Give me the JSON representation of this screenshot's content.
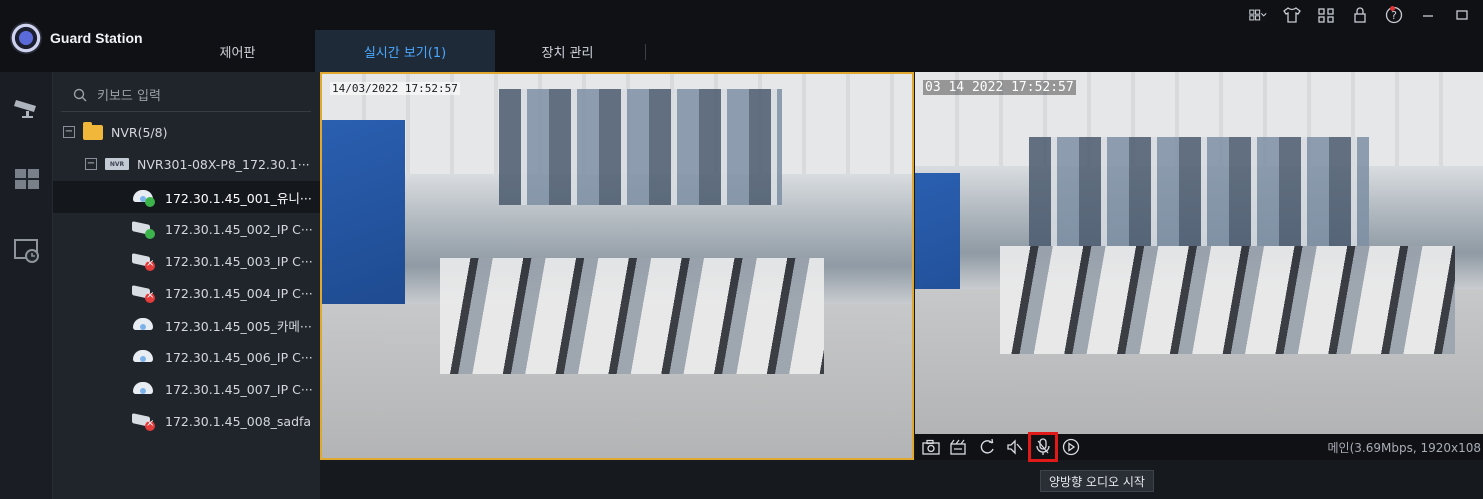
{
  "app": {
    "name": "Guard Station"
  },
  "tabs": [
    {
      "label": "제어판"
    },
    {
      "label": "실시간 보기(1)"
    },
    {
      "label": "장치 관리"
    }
  ],
  "window_controls": [
    "layout-grid-icon",
    "tshirt-icon",
    "network-icon",
    "lock-icon",
    "help-icon",
    "minimize-icon",
    "maximize-icon"
  ],
  "search": {
    "placeholder": "키보드 입력"
  },
  "tree": {
    "root": "NVR(5/8)",
    "nvr": "NVR301-08X-P8_172.30.1···",
    "nvr_badge": "NVR",
    "cameras": [
      {
        "label": "172.30.1.45_001_유니···",
        "status": "online",
        "type": "dome"
      },
      {
        "label": "172.30.1.45_002_IP C···",
        "status": "online",
        "type": "bullet"
      },
      {
        "label": "172.30.1.45_003_IP C···",
        "status": "offline",
        "type": "bullet"
      },
      {
        "label": "172.30.1.45_004_IP C···",
        "status": "offline",
        "type": "bullet"
      },
      {
        "label": "172.30.1.45_005_카메···",
        "status": "online",
        "type": "dome"
      },
      {
        "label": "172.30.1.45_006_IP C···",
        "status": "online",
        "type": "dome"
      },
      {
        "label": "172.30.1.45_007_IP C···",
        "status": "online",
        "type": "dome"
      },
      {
        "label": "172.30.1.45_008_sadfa",
        "status": "offline",
        "type": "bullet"
      }
    ]
  },
  "panes": [
    {
      "osd": "14/03/2022 17:52:57"
    },
    {
      "osd": "03 14 2022 17:52:57"
    }
  ],
  "pane_toolbar": {
    "buttons": [
      "snapshot-icon",
      "record-icon",
      "ptz-icon",
      "audio-icon",
      "microphone-icon",
      "playback-icon"
    ],
    "stream_info": "메인(3.69Mbps, 1920x108"
  },
  "tooltip": "양방향 오디오 시작",
  "colors": {
    "accent": "#4aa8ff",
    "selected_border": "#e0a82e",
    "highlight": "#e01919"
  }
}
